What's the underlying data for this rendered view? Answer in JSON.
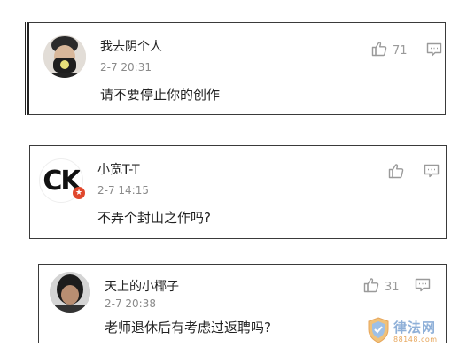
{
  "comments": [
    {
      "user": "我去阴个人",
      "time": "2-7 20:31",
      "text": "请不要停止你的创作",
      "likes": "71"
    },
    {
      "user": "小宽T-T",
      "time": "2-7 14:15",
      "text": "不弄个封山之作吗?",
      "likes": "",
      "avatar_text": "CK"
    },
    {
      "user": "天上的小椰子",
      "time": "2-7 20:38",
      "text": "老师退休后有考虑过返聘吗?",
      "likes": "31"
    }
  ],
  "icons": {
    "like": "thumbs-up-icon",
    "reply": "comment-icon"
  },
  "watermark": {
    "title": "律法网",
    "sub": "88148.com"
  }
}
